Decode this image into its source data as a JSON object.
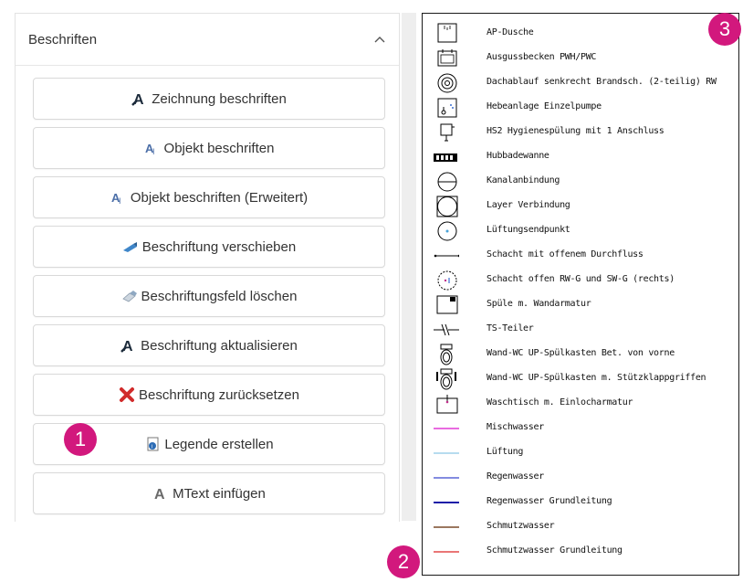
{
  "panel": {
    "title": "Beschriften",
    "buttons": [
      {
        "label": "Zeichnung beschriften",
        "icon": "text-a-dark-icon"
      },
      {
        "label": "Objekt beschriften",
        "icon": "text-a-blue-icon"
      },
      {
        "label": "Objekt beschriften (Erweitert)",
        "icon": "text-a-blue-icon"
      },
      {
        "label": "Beschriftung verschieben",
        "icon": "move-label-icon"
      },
      {
        "label": "Beschriftungsfeld löschen",
        "icon": "eraser-icon"
      },
      {
        "label": "Beschriftung aktualisieren",
        "icon": "text-a-dark-icon"
      },
      {
        "label": "Beschriftung zurücksetzen",
        "icon": "red-x-icon"
      },
      {
        "label": "Legende erstellen",
        "icon": "legend-doc-icon"
      },
      {
        "label": "MText einfügen",
        "icon": "text-a-gray-icon"
      }
    ]
  },
  "legend": {
    "items": [
      {
        "label": "AP-Dusche",
        "symbol": "shower"
      },
      {
        "label": "Ausgussbecken PWH/PWC",
        "symbol": "sink-basin"
      },
      {
        "label": "Dachablauf senkrecht Brandsch. (2-teilig) RW",
        "symbol": "roof-drain"
      },
      {
        "label": "Hebeanlage Einzelpumpe",
        "symbol": "lifting-unit"
      },
      {
        "label": "HS2 Hygienespülung mit 1 Anschluss",
        "symbol": "hygiene-flush"
      },
      {
        "label": "Hubbadewanne",
        "symbol": "lift-bathtub"
      },
      {
        "label": "Kanalanbindung",
        "symbol": "sewer-connection"
      },
      {
        "label": "Layer Verbindung",
        "symbol": "layer-connection"
      },
      {
        "label": "Lüftungsendpunkt",
        "symbol": "vent-endpoint"
      },
      {
        "label": "Schacht mit offenem Durchfluss",
        "symbol": "shaft-open-flow"
      },
      {
        "label": "Schacht offen RW-G und SW-G (rechts)",
        "symbol": "shaft-open"
      },
      {
        "label": "Spüle m. Wandarmatur",
        "symbol": "kitchen-sink"
      },
      {
        "label": "TS-Teiler",
        "symbol": "ts-divider"
      },
      {
        "label": "Wand-WC UP-Spülkasten Bet. von vorne",
        "symbol": "wall-wc"
      },
      {
        "label": "Wand-WC UP-Spülkasten m. Stützklappgriffen",
        "symbol": "wall-wc-grab"
      },
      {
        "label": "Waschtisch m. Einlocharmatur",
        "symbol": "washbasin"
      },
      {
        "label": "Mischwasser",
        "symbol": "line",
        "color": "#e23ad6"
      },
      {
        "label": "Lüftung",
        "symbol": "line",
        "color": "#9fd0ea"
      },
      {
        "label": "Regenwasser",
        "symbol": "line",
        "color": "#5a67d6"
      },
      {
        "label": "Regenwasser Grundleitung",
        "symbol": "line",
        "color": "#1c1ca8"
      },
      {
        "label": "Schmutzwasser",
        "symbol": "line",
        "color": "#7a4a2a"
      },
      {
        "label": "Schmutzwasser Grundleitung",
        "symbol": "line",
        "color": "#e34848"
      }
    ]
  },
  "badges": {
    "one": "1",
    "two": "2",
    "three": "3"
  },
  "colors": {
    "badge": "#d2187d",
    "border": "#d9d9d9"
  }
}
